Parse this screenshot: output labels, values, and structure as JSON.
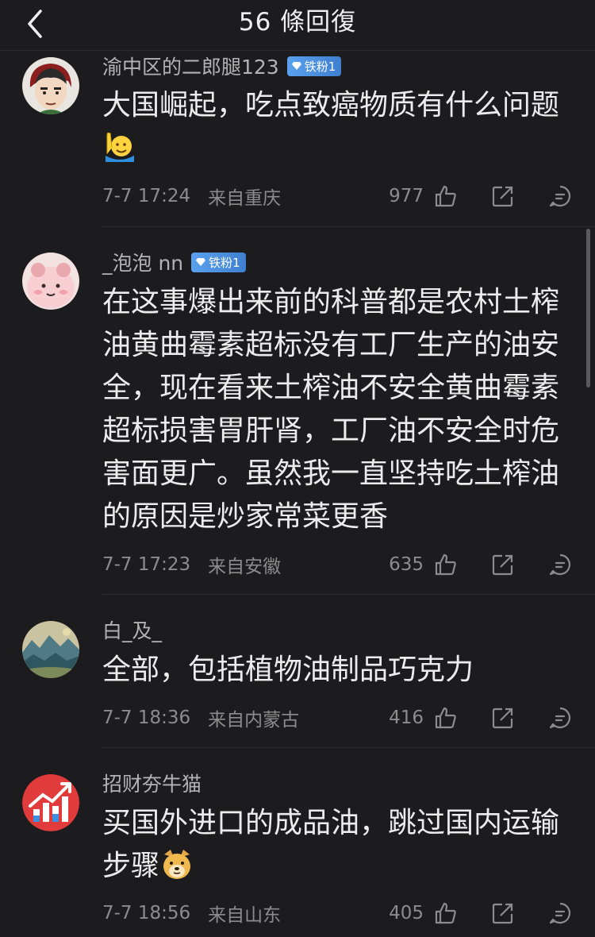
{
  "header": {
    "title": "56 條回復"
  },
  "comments": [
    {
      "user": "渝中区的二郎腿123",
      "badge": "铁粉1",
      "text": "大国崛起，吃点致癌物质有什么问题",
      "emoji": "raising-hand-emoji",
      "time": "7-7 17:24",
      "location": "来自重庆",
      "likes": "977"
    },
    {
      "user": "_泡泡 nn",
      "badge": "铁粉1",
      "text": "在这事爆出来前的科普都是农村土榨油黄曲霉素超标没有工厂生产的油安全，现在看来土榨油不安全黄曲霉素超标损害胃肝肾，工厂油不安全时危害面更广。虽然我一直坚持吃土榨油的原因是炒家常菜更香",
      "time": "7-7 17:23",
      "location": "来自安徽",
      "likes": "635"
    },
    {
      "user": "白_及_",
      "text": "全部，包括植物油制品巧克力",
      "time": "7-7 18:36",
      "location": "来自内蒙古",
      "likes": "416"
    },
    {
      "user": "招财夯牛猫",
      "text": "买国外进口的成品油，跳过国内运输步骤",
      "emoji": "doge-emoji",
      "time": "7-7 18:56",
      "location": "来自山东",
      "likes": "405"
    }
  ],
  "colors": {
    "background": "#1c1c1e",
    "badge": "#4f8fd8",
    "meta": "#8c8c8c"
  }
}
